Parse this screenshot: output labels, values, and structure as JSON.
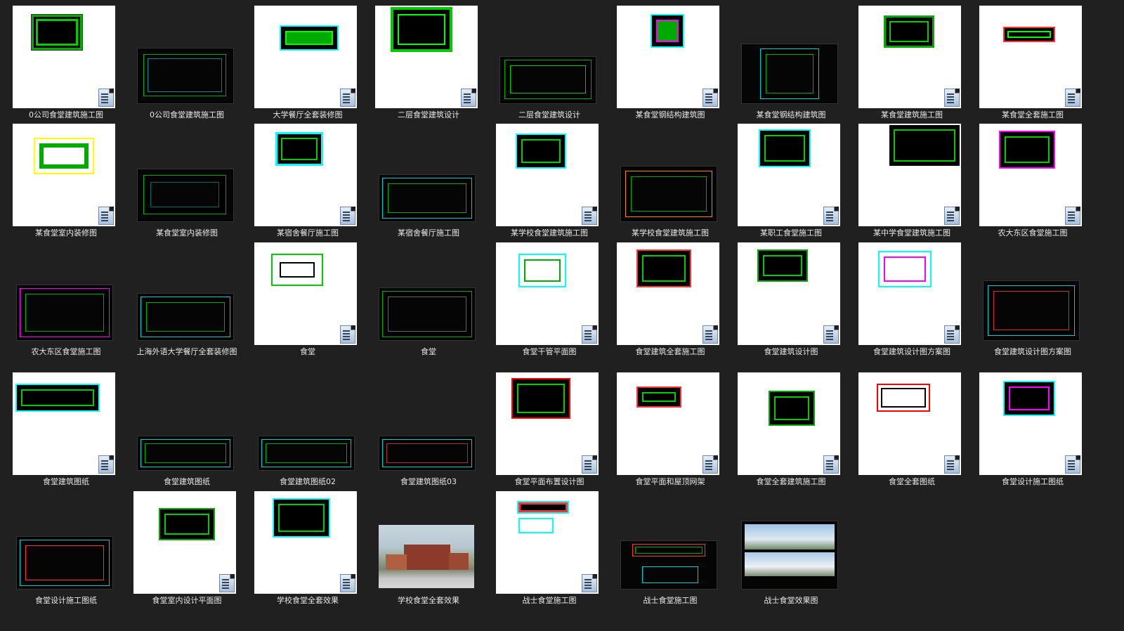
{
  "files": [
    {
      "name": "0公司食堂建筑施工图",
      "thumb": "white-cad"
    },
    {
      "name": "0公司食堂建筑施工图",
      "thumb": "dark-cad"
    },
    {
      "name": "大学餐厅全套装修图",
      "thumb": "white-cad"
    },
    {
      "name": "二层食堂建筑设计",
      "thumb": "white-cad"
    },
    {
      "name": "二层食堂建筑设计",
      "thumb": "dark-cad"
    },
    {
      "name": "某食堂钢结构建筑图",
      "thumb": "white-cad"
    },
    {
      "name": "某食堂钢结构建筑图",
      "thumb": "dark-cad"
    },
    {
      "name": "某食堂建筑施工图",
      "thumb": "white-cad"
    },
    {
      "name": "某食堂全套施工图",
      "thumb": "white-cad"
    },
    {
      "name": "某食堂室内装修图",
      "thumb": "white-cad"
    },
    {
      "name": "某食堂室内装修图",
      "thumb": "dark-cad"
    },
    {
      "name": "某宿舍餐厅施工图",
      "thumb": "white-cad"
    },
    {
      "name": "某宿舍餐厅施工图",
      "thumb": "dark-cad"
    },
    {
      "name": "某学校食堂建筑施工图",
      "thumb": "white-cad"
    },
    {
      "name": "某学校食堂建筑施工图",
      "thumb": "dark-cad"
    },
    {
      "name": "某职工食堂施工图",
      "thumb": "white-cad"
    },
    {
      "name": "某中学食堂建筑施工图",
      "thumb": "white-cad"
    },
    {
      "name": "农大东区食堂施工图",
      "thumb": "white-cad"
    },
    {
      "name": "农大东区食堂施工图",
      "thumb": "dark-cad"
    },
    {
      "name": "上海外语大学餐厅全套装修图",
      "thumb": "dark-cad"
    },
    {
      "name": "食堂",
      "thumb": "white-cad"
    },
    {
      "name": "食堂",
      "thumb": "dark-cad"
    },
    {
      "name": "食堂干管平面图",
      "thumb": "white-cad"
    },
    {
      "name": "食堂建筑全套施工图",
      "thumb": "white-cad"
    },
    {
      "name": "食堂建筑设计图",
      "thumb": "white-cad"
    },
    {
      "name": "食堂建筑设计图方案图",
      "thumb": "white-cad"
    },
    {
      "name": "食堂建筑设计图方案图",
      "thumb": "dark-cad"
    },
    {
      "name": "食堂建筑图纸",
      "thumb": "white-cad"
    },
    {
      "name": "食堂建筑图纸",
      "thumb": "dark-cad"
    },
    {
      "name": "食堂建筑图纸02",
      "thumb": "dark-cad"
    },
    {
      "name": "食堂建筑图纸03",
      "thumb": "dark-cad"
    },
    {
      "name": "食堂平面布置设计图",
      "thumb": "white-cad"
    },
    {
      "name": "食堂平面和屋顶网架",
      "thumb": "white-cad"
    },
    {
      "name": "食堂全套建筑施工图",
      "thumb": "white-cad"
    },
    {
      "name": "食堂全套图纸",
      "thumb": "white-cad"
    },
    {
      "name": "食堂设计施工图纸",
      "thumb": "white-cad"
    },
    {
      "name": "食堂设计施工图纸",
      "thumb": "dark-cad"
    },
    {
      "name": "食堂室内设计平面图",
      "thumb": "white-cad"
    },
    {
      "name": "学校食堂全套效果",
      "thumb": "white-cad"
    },
    {
      "name": "学校食堂全套效果",
      "thumb": "photo"
    },
    {
      "name": "战士食堂施工图",
      "thumb": "white-cad"
    },
    {
      "name": "战士食堂施工图",
      "thumb": "dark-cad"
    },
    {
      "name": "战士食堂效果图",
      "thumb": "photo-dark"
    }
  ],
  "colors": {
    "background": "#202020",
    "cad_green": "#00ff00",
    "cad_cyan": "#00ffff",
    "label": "#e8e8e8"
  }
}
